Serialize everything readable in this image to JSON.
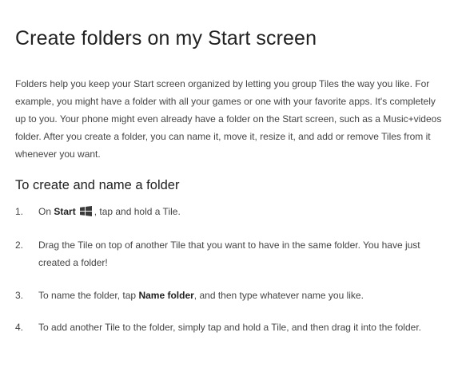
{
  "page": {
    "title": "Create folders on my Start screen",
    "intro": "Folders help you keep your Start screen organized by letting you group Tiles the way you like. For example, you might have a folder with all your games or one with your favorite apps. It's completely up to you. Your phone might even already have a folder on the Start screen, such as a Music+videos folder. After you create a folder, you can name it, move it, resize it, and add or remove Tiles from it whenever you want.",
    "section_heading": "To create and name a folder"
  },
  "steps": [
    {
      "num": "1.",
      "before": "On",
      "bold": "Start",
      "icon": "windows-logo-icon",
      "after": ", tap and hold a Tile."
    },
    {
      "num": "2.",
      "text": "Drag the Tile on top of another Tile that you want to have in the same folder. You have just created a folder!"
    },
    {
      "num": "3.",
      "before": "To name the folder, tap",
      "bold": "Name folder",
      "after": ", and then type whatever name you like."
    },
    {
      "num": "4.",
      "text": "To add another Tile to the folder, simply tap and hold a Tile, and then drag it into the folder."
    }
  ],
  "colors": {
    "heading": "#222222",
    "body_text": "#444444",
    "background": "#ffffff"
  }
}
